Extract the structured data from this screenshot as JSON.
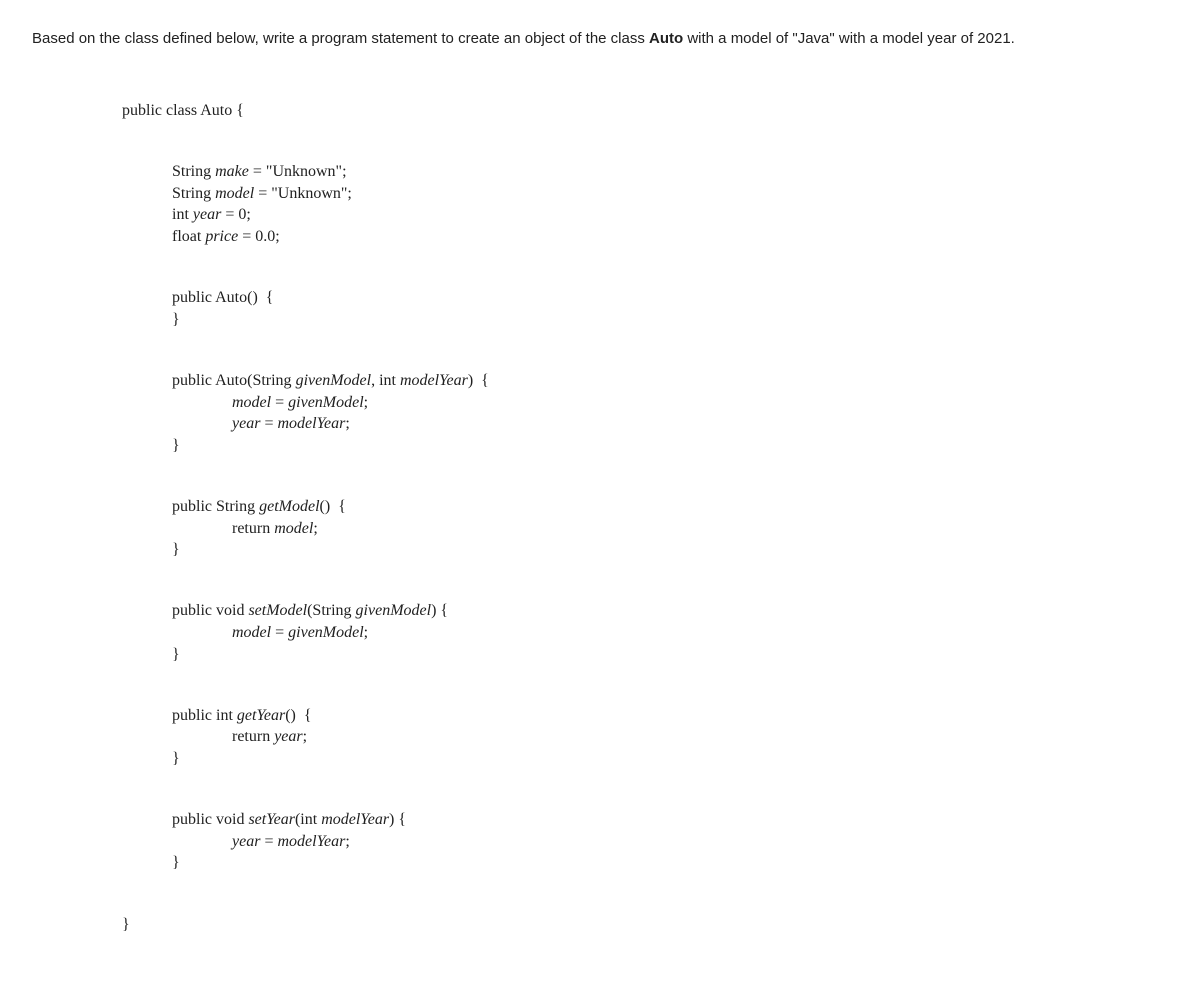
{
  "question": {
    "prefix": "Based on the class defined below, write a program statement to create an object of the class ",
    "bold": "Auto",
    "suffix": " with a model of \"Java\" with a model year of 2021."
  },
  "code": {
    "classDecl": "public class Auto {",
    "field1_a": "String ",
    "field1_b": "make",
    "field1_c": " = \"Unknown\";",
    "field2_a": "String ",
    "field2_b": "model",
    "field2_c": " = \"Unknown\";",
    "field3_a": "int ",
    "field3_b": "year",
    "field3_c": " = 0;",
    "field4_a": "float ",
    "field4_b": "price",
    "field4_c": " = 0.0;",
    "ctor1_sig": "public Auto()  {",
    "ctor1_close": "}",
    "ctor2_sig_a": "public Auto(String ",
    "ctor2_sig_b": "givenModel",
    "ctor2_sig_c": ", int ",
    "ctor2_sig_d": "modelYear",
    "ctor2_sig_e": ")  {",
    "ctor2_l1_a": "model",
    "ctor2_l1_b": " = ",
    "ctor2_l1_c": "givenModel",
    "ctor2_l1_d": ";",
    "ctor2_l2_a": "year",
    "ctor2_l2_b": " = ",
    "ctor2_l2_c": "modelYear",
    "ctor2_l2_d": ";",
    "ctor2_close": "}",
    "getModel_sig_a": "public String ",
    "getModel_sig_b": "getModel",
    "getModel_sig_c": "()  {",
    "getModel_l1_a": "return ",
    "getModel_l1_b": "model",
    "getModel_l1_c": ";",
    "getModel_close": "}",
    "setModel_sig_a": "public void ",
    "setModel_sig_b": "setModel",
    "setModel_sig_c": "(String ",
    "setModel_sig_d": "givenModel",
    "setModel_sig_e": ") {",
    "setModel_l1_a": "model",
    "setModel_l1_b": " = ",
    "setModel_l1_c": "givenModel",
    "setModel_l1_d": ";",
    "setModel_close": "}",
    "getYear_sig_a": "public int ",
    "getYear_sig_b": "getYear",
    "getYear_sig_c": "()  {",
    "getYear_l1_a": "return ",
    "getYear_l1_b": "year",
    "getYear_l1_c": ";",
    "getYear_close": "}",
    "setYear_sig_a": "public void ",
    "setYear_sig_b": "setYear",
    "setYear_sig_c": "(int ",
    "setYear_sig_d": "modelYear",
    "setYear_sig_e": ") {",
    "setYear_l1_a": "year",
    "setYear_l1_b": " = ",
    "setYear_l1_c": "modelYear",
    "setYear_l1_d": ";",
    "setYear_close": "}",
    "classClose": "}"
  }
}
